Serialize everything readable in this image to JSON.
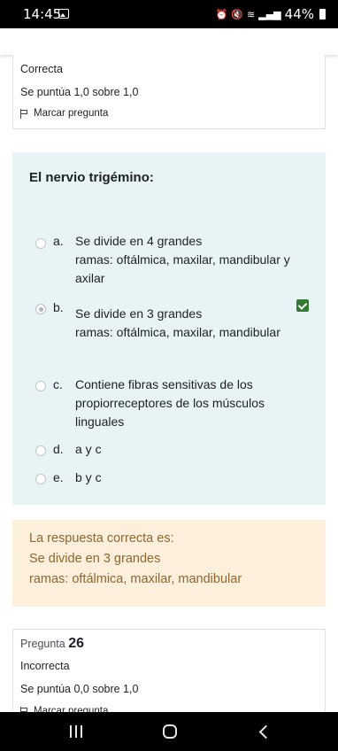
{
  "status_bar": {
    "time": "14:45",
    "battery": "44%",
    "icons": [
      "image-icon",
      "alarm-icon",
      "mute-icon",
      "wifi-icon",
      "signal-icon",
      "battery-icon"
    ]
  },
  "previous_question": {
    "state": "Correcta",
    "grade": "Se puntúa 1,0 sobre 1,0",
    "flag_label": "Marcar pregunta"
  },
  "question": {
    "text": "El nervio trigémino:",
    "answers": [
      {
        "letter": "a.",
        "lines": [
          "Se divide en 4 grandes",
          "ramas: oftálmica, maxilar, mandibular y",
          "axilar"
        ],
        "selected": false
      },
      {
        "letter": "b.",
        "lines": [
          "Se divide en 3 grandes",
          "ramas: oftálmica, maxilar, mandibular"
        ],
        "selected": true,
        "correct": true
      },
      {
        "letter": "c.",
        "lines": [
          "Contiene fibras sensitivas de los",
          "propiorreceptores de los músculos",
          "linguales"
        ],
        "selected": false
      },
      {
        "letter": "d.",
        "lines": [
          "a y c"
        ],
        "selected": false
      },
      {
        "letter": "e.",
        "lines": [
          "b y c"
        ],
        "selected": false
      }
    ]
  },
  "feedback": {
    "heading": "La respuesta correcta es:",
    "lines": [
      "Se divide en 3 grandes",
      "ramas: oftálmica, maxilar, mandibular"
    ]
  },
  "next_question": {
    "prefix": "Pregunta",
    "number": "26",
    "state": "Incorrecta",
    "grade": "Se puntúa 0,0 sobre 1,0",
    "flag_label": "Marcar pregunta"
  },
  "colors": {
    "question_bg": "#e7f3f5",
    "feedback_bg": "#fcefdc",
    "feedback_text": "#8e662e",
    "correct_green": "#357a32"
  }
}
